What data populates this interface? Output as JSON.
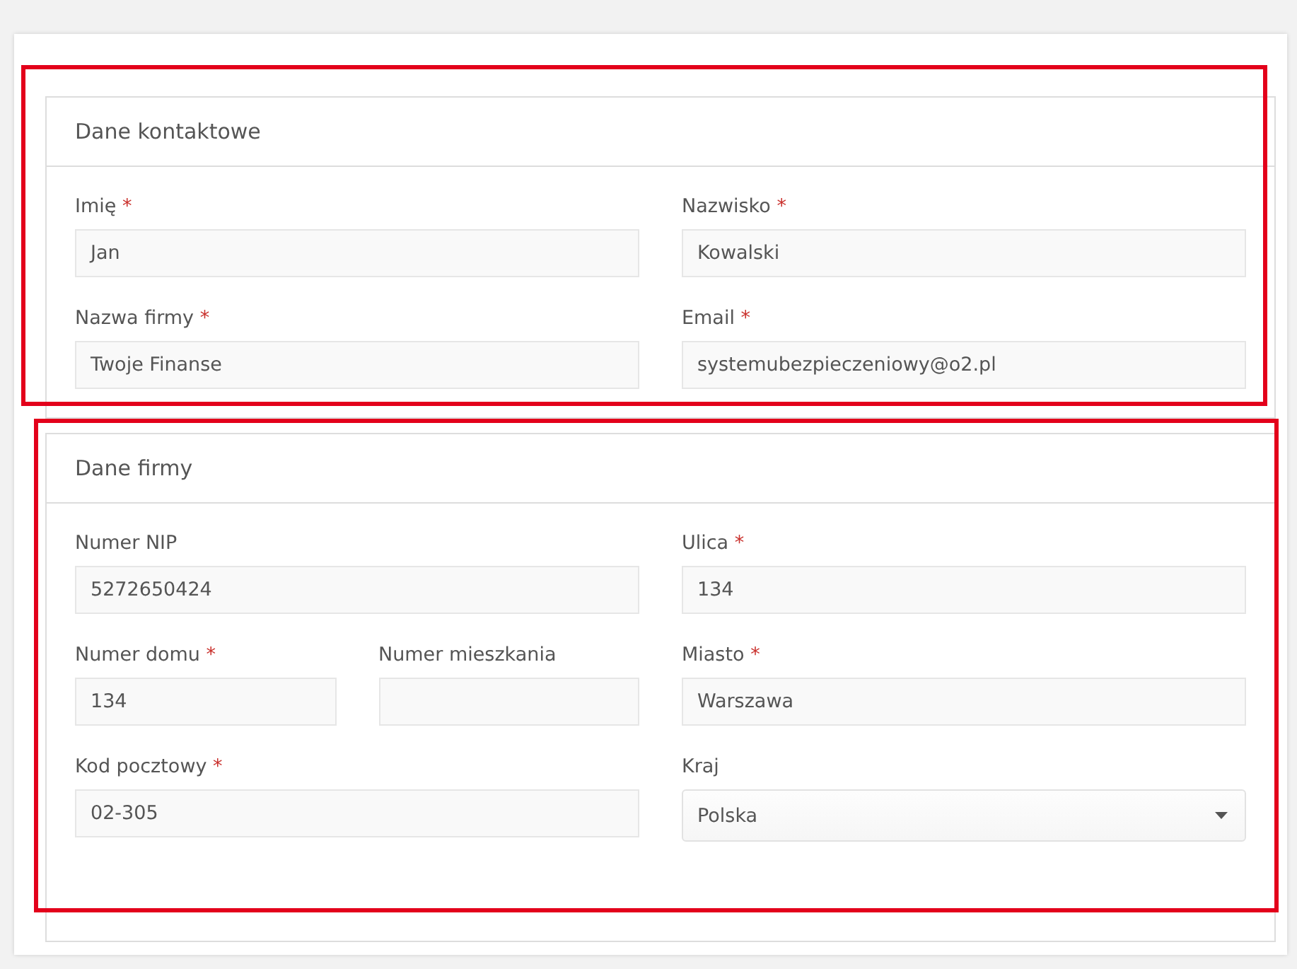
{
  "sections": [
    {
      "title": "Dane kontaktowe",
      "highlighted": true,
      "rows": [
        [
          {
            "kind": "field",
            "label": "Imię",
            "required_mark": "*",
            "value": "Jan"
          },
          {
            "kind": "field",
            "label": "Nazwisko",
            "required_mark": "*",
            "value": "Kowalski"
          }
        ],
        [
          {
            "kind": "field",
            "label": "Nazwa firmy",
            "required_mark": "*",
            "value": "Twoje Finanse"
          },
          {
            "kind": "field",
            "label": "Email",
            "required_mark": "*",
            "value": "systemubezpieczeniowy@o2.pl"
          }
        ]
      ]
    },
    {
      "title": "Dane firmy",
      "highlighted": true,
      "rows": [
        [
          {
            "kind": "field",
            "label": "Numer NIP",
            "value": "5272650424"
          },
          {
            "kind": "field",
            "label": "Ulica",
            "required_mark": "*",
            "value": "134"
          }
        ],
        [
          {
            "kind": "pair",
            "fields": [
              {
                "kind": "field",
                "label": "Numer domu",
                "required_mark": "*",
                "value": "134"
              },
              {
                "kind": "field",
                "label": "Numer mieszkania"
              }
            ]
          },
          {
            "kind": "field",
            "label": "Miasto",
            "required_mark": "*",
            "value": "Warszawa"
          }
        ],
        [
          {
            "kind": "field",
            "label": "Kod pocztowy",
            "required_mark": "*",
            "value": "02-305"
          },
          {
            "kind": "select",
            "label": "Kraj",
            "value": "Polska"
          }
        ]
      ]
    }
  ]
}
